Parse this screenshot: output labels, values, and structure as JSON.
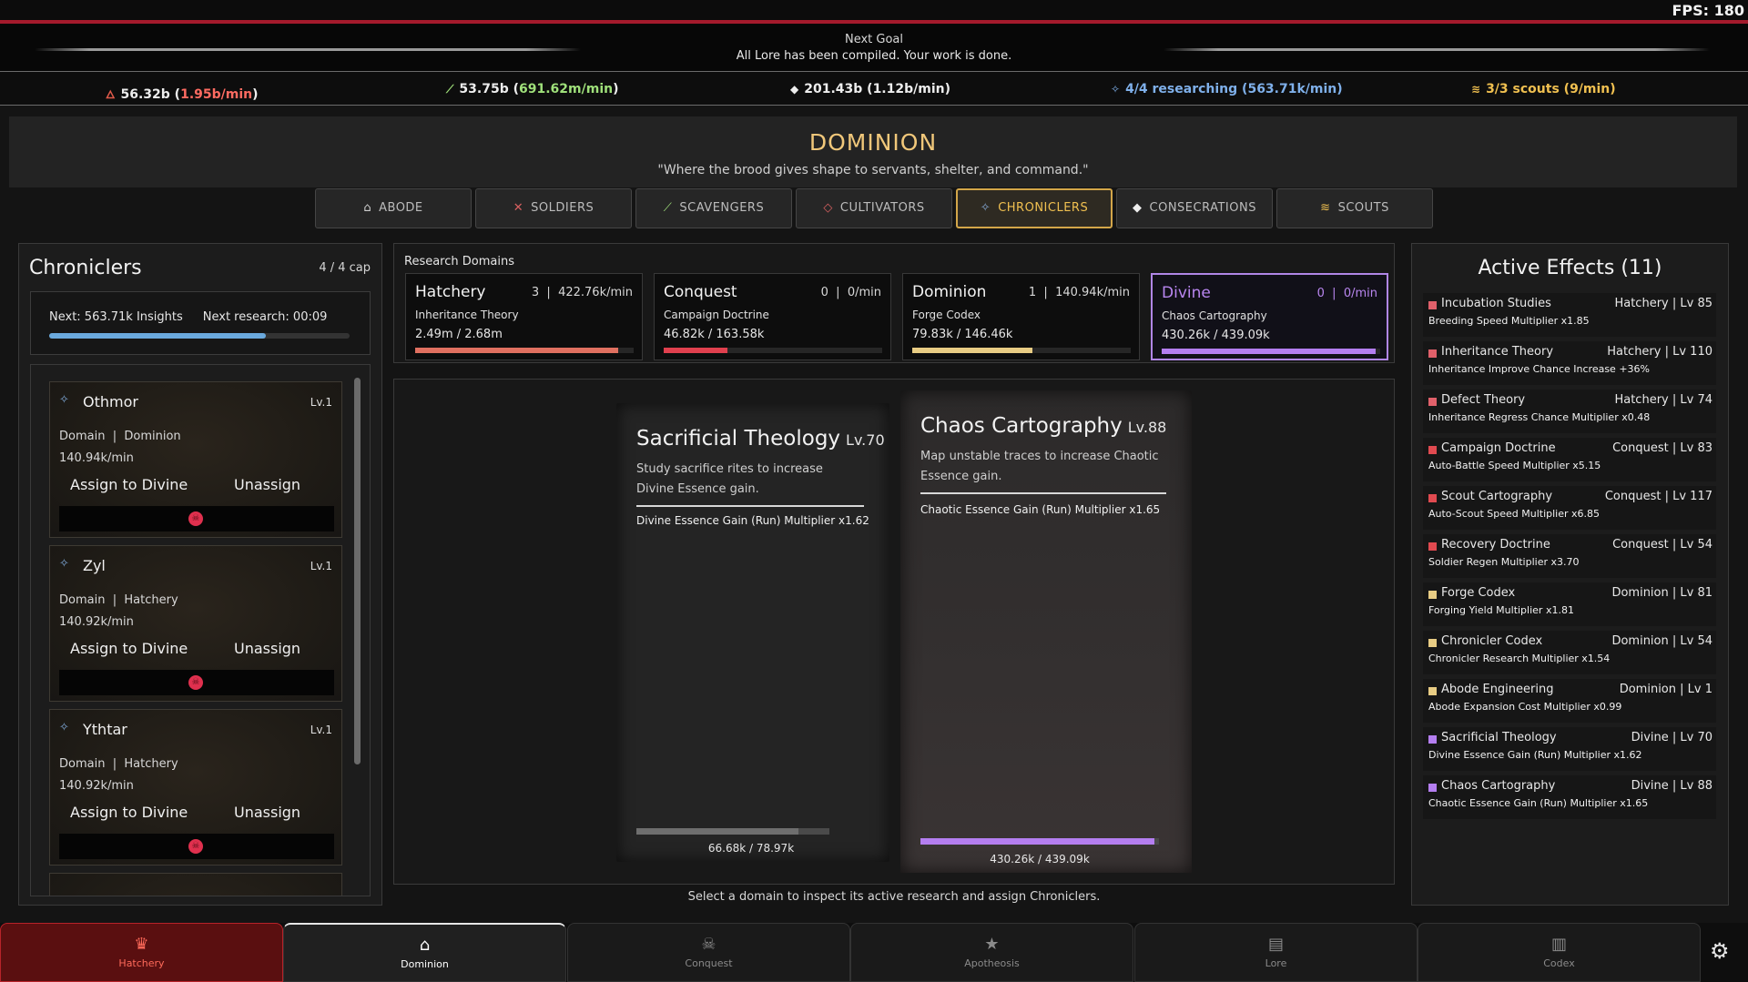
{
  "fps": "FPS: 180",
  "goal": {
    "title": "Next Goal",
    "text": "All Lore has been compiled. Your work is done."
  },
  "resources": [
    {
      "value": "56.32b",
      "rate": "1.95b/min",
      "rate_color": "#ff6b61",
      "color": "#ededed",
      "icon": "flame-icon",
      "glyph": "🜂"
    },
    {
      "value": "53.75b",
      "rate": "691.62m/min",
      "rate_color": "#9fe07a",
      "color": "#ededed",
      "icon": "leaf-icon",
      "glyph": "⟋"
    },
    {
      "value": "201.43b",
      "rate": "1.12b/min",
      "rate_color": "#ededed",
      "color": "#ededed",
      "icon": "drop-icon",
      "glyph": "◆"
    },
    {
      "value": "4/4 researching",
      "rate": "563.71k/min",
      "rate_color": "#7fb0ea",
      "color": "#7fb0ea",
      "icon": "brain-icon",
      "glyph": "✧"
    },
    {
      "value": "3/3 scouts",
      "rate": "9/min",
      "rate_color": "#f0c050",
      "color": "#f0c050",
      "icon": "wing-icon",
      "glyph": "≋"
    }
  ],
  "header": {
    "title": "DOMINION",
    "subtitle": "\"Where the brood gives shape to servants, shelter, and command.\""
  },
  "tabs": [
    {
      "label": "ABODE",
      "icon": "house-icon",
      "glyph": "⌂"
    },
    {
      "label": "SOLDIERS",
      "icon": "swords-icon",
      "glyph": "✕"
    },
    {
      "label": "SCAVENGERS",
      "icon": "pickaxe-icon",
      "glyph": "⟋"
    },
    {
      "label": "CULTIVATORS",
      "icon": "eye-icon",
      "glyph": "◇"
    },
    {
      "label": "CHRONICLERS",
      "icon": "brain-icon",
      "glyph": "✧"
    },
    {
      "label": "CONSECRATIONS",
      "icon": "drop-icon",
      "glyph": "◆"
    },
    {
      "label": "SCOUTS",
      "icon": "wing-icon",
      "glyph": "≋"
    }
  ],
  "chroniclers": {
    "title": "Chroniclers",
    "cap": "4 / 4 cap",
    "next_insights": "Next: 563.71k Insights",
    "next_research": "Next research: 00:09",
    "progress_fraction": 0.72,
    "progress_color": "#6aa9dd",
    "cards": [
      {
        "name": "Othmor",
        "level": "Lv.1",
        "domain_label": "Domain",
        "domain": "Dominion",
        "rate": "140.94k/min",
        "assign": "Assign to Divine",
        "unassign": "Unassign"
      },
      {
        "name": "Zyl",
        "level": "Lv.1",
        "domain_label": "Domain",
        "domain": "Hatchery",
        "rate": "140.92k/min",
        "assign": "Assign to Divine",
        "unassign": "Unassign"
      },
      {
        "name": "Ythtar",
        "level": "Lv.1",
        "domain_label": "Domain",
        "domain": "Hatchery",
        "rate": "140.92k/min",
        "assign": "Assign to Divine",
        "unassign": "Unassign"
      }
    ]
  },
  "research_domains": {
    "title": "Research Domains",
    "items": [
      {
        "name": "Hatchery",
        "count": "3",
        "rate": "422.76k/min",
        "research": "Inheritance Theory",
        "progress": "2.49m / 2.68m",
        "fraction": 0.93,
        "color": "#e07060",
        "name_color": "#f2f2f2"
      },
      {
        "name": "Conquest",
        "count": "0",
        "rate": "0/min",
        "research": "Campaign Doctrine",
        "progress": "46.82k / 163.58k",
        "fraction": 0.29,
        "color": "#e0404e",
        "name_color": "#f2f2f2"
      },
      {
        "name": "Dominion",
        "count": "1",
        "rate": "140.94k/min",
        "research": "Forge Codex",
        "progress": "79.83k / 146.46k",
        "fraction": 0.55,
        "color": "#e8cc84",
        "name_color": "#f2f2f2"
      },
      {
        "name": "Divine",
        "count": "0",
        "rate": "0/min",
        "research": "Chaos Cartography",
        "progress": "430.26k / 439.09k",
        "fraction": 0.98,
        "color": "#b47ef0",
        "name_color": "#b986f0"
      }
    ]
  },
  "research_cards": [
    {
      "title": "Sacrificial Theology",
      "level": "Lv.70",
      "description": "Study sacrifice rites to increase Divine Essence gain.",
      "effect": "Divine Essence Gain (Run) Multiplier x1.62",
      "progress": "66.68k / 78.97k",
      "fraction": 0.84,
      "color": "#6e6e6e"
    },
    {
      "title": "Chaos Cartography",
      "level": "Lv.88",
      "description": "Map unstable traces to increase Chaotic Essence gain.",
      "effect": "Chaotic Essence Gain (Run) Multiplier x1.65",
      "progress": "430.26k / 439.09k",
      "fraction": 0.98,
      "color": "#b47ef0"
    }
  ],
  "hint": "Select a domain to inspect its active research and assign Chroniclers.",
  "effects": {
    "title": "Active Effects (11)",
    "items": [
      {
        "name": "Incubation Studies",
        "domain": "Hatchery | Lv 85",
        "desc": "Breeding Speed Multiplier x1.85",
        "color": "#e0606a"
      },
      {
        "name": "Inheritance Theory",
        "domain": "Hatchery | Lv 110",
        "desc": "Inheritance Improve Chance Increase +36%",
        "color": "#e0606a"
      },
      {
        "name": "Defect Theory",
        "domain": "Hatchery | Lv 74",
        "desc": "Inheritance Regress Chance Multiplier x0.48",
        "color": "#e0606a"
      },
      {
        "name": "Campaign Doctrine",
        "domain": "Conquest | Lv 83",
        "desc": "Auto-Battle Speed Multiplier x5.15",
        "color": "#e04a50"
      },
      {
        "name": "Scout Cartography",
        "domain": "Conquest | Lv 117",
        "desc": "Auto-Scout Speed Multiplier x6.85",
        "color": "#e04a50"
      },
      {
        "name": "Recovery Doctrine",
        "domain": "Conquest | Lv 54",
        "desc": "Soldier Regen Multiplier x3.70",
        "color": "#e04a50"
      },
      {
        "name": "Forge Codex",
        "domain": "Dominion | Lv 81",
        "desc": "Forging Yield Multiplier x1.81",
        "color": "#e8cc84"
      },
      {
        "name": "Chronicler Codex",
        "domain": "Dominion | Lv 54",
        "desc": "Chronicler Research Multiplier x1.54",
        "color": "#e8cc84"
      },
      {
        "name": "Abode Engineering",
        "domain": "Dominion | Lv 1",
        "desc": "Abode Expansion Cost Multiplier x0.99",
        "color": "#e8cc84"
      },
      {
        "name": "Sacrificial Theology",
        "domain": "Divine | Lv 70",
        "desc": "Divine Essence Gain (Run) Multiplier x1.62",
        "color": "#b47ef0"
      },
      {
        "name": "Chaos Cartography",
        "domain": "Divine | Lv 88",
        "desc": "Chaotic Essence Gain (Run) Multiplier x1.65",
        "color": "#b47ef0"
      }
    ]
  },
  "bottom_nav": [
    {
      "label": "Hatchery",
      "icon": "crown-icon",
      "glyph": "♛"
    },
    {
      "label": "Dominion",
      "icon": "house-icon",
      "glyph": "⌂"
    },
    {
      "label": "Conquest",
      "icon": "skull-icon",
      "glyph": "☠"
    },
    {
      "label": "Apotheosis",
      "icon": "star-icon",
      "glyph": "★"
    },
    {
      "label": "Lore",
      "icon": "scroll-icon",
      "glyph": "▤"
    },
    {
      "label": "Codex",
      "icon": "book-icon",
      "glyph": "▥"
    }
  ],
  "settings_icon": "gear-icon"
}
